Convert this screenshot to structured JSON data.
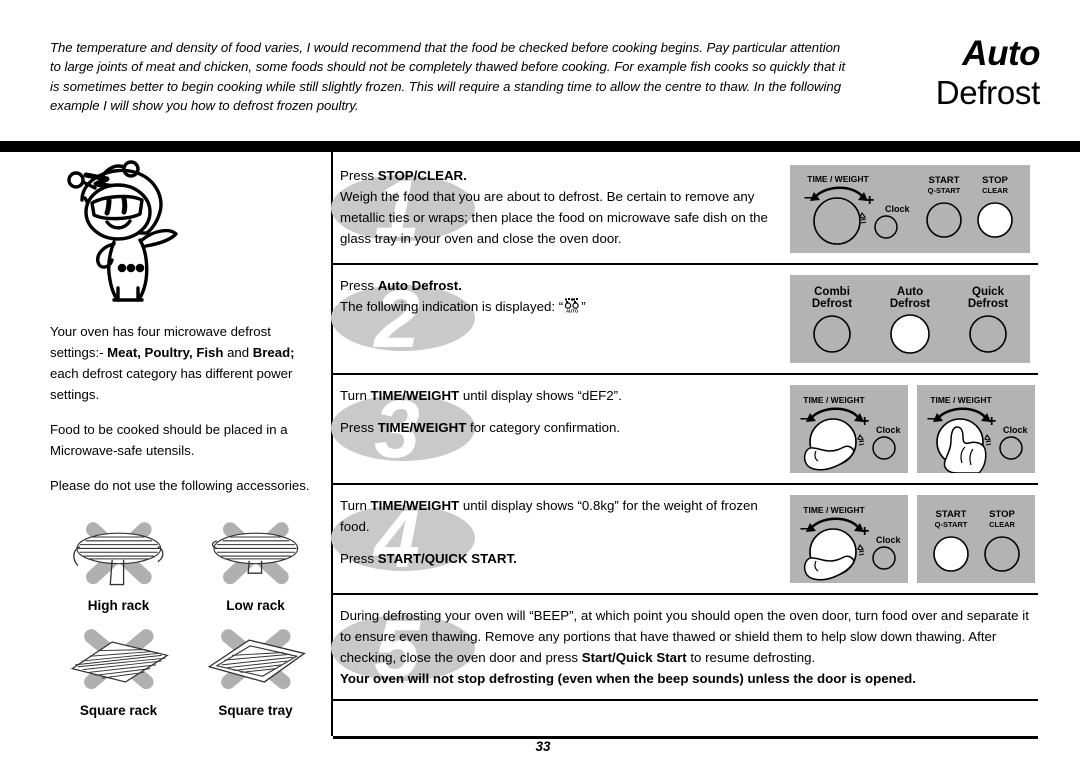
{
  "document": {
    "title_line1": "Auto",
    "title_line2": "Defrost",
    "page_number": "33",
    "intro_paragraph": "The temperature and density of food varies, I would recommend that the food be checked before cooking begins. Pay particular attention to large joints of meat and chicken, some foods should not be completely thawed before cooking. For example fish cooks so quickly that it is sometimes better to begin cooking while still slightly frozen. This will require a standing time to allow the centre to thaw. In the following example I will show you how to defrost frozen poultry."
  },
  "sidebar": {
    "mascot_alt": "chef-mascot-character",
    "paragraph1_pre": "Your oven has four microwave defrost settings:- ",
    "paragraph1_bold1": "Meat, Poultry, Fish",
    "paragraph1_mid": " and ",
    "paragraph1_bold2": "Bread;",
    "paragraph1_post": " each defrost category has different power settings.",
    "paragraph2": "Food to be cooked should be placed in a Microwave-safe utensils.",
    "paragraph3": "Please do not use the following accessories.",
    "accessories": [
      {
        "label": "High rack",
        "icon": "high-rack-icon"
      },
      {
        "label": "Low rack",
        "icon": "low-rack-icon"
      },
      {
        "label": "Square rack",
        "icon": "square-rack-icon"
      },
      {
        "label": "Square tray",
        "icon": "square-tray-icon"
      }
    ]
  },
  "steps": [
    {
      "number": "1",
      "line1_pre": "Press ",
      "line1_bold": "STOP/CLEAR.",
      "body": "Weigh the food that you are about to defrost. Be certain to remove any metallic ties or wraps; then place the food on microwave safe dish on the glass tray in your oven and close the oven door."
    },
    {
      "number": "2",
      "line1_pre": "Press ",
      "line1_bold": "Auto Defrost.",
      "body_pre": "The following indication is displayed: “",
      "display_icon": "auto-defrost-display-icon",
      "display_icon_label": "AUTO",
      "body_post": "”"
    },
    {
      "number": "3",
      "line1_pre": "Turn ",
      "line1_bold": "TIME/WEIGHT",
      "line1_post": " until display shows “dEF2”.",
      "line2_pre": "Press ",
      "line2_bold": "TIME/WEIGHT",
      "line2_post": " for category confirmation."
    },
    {
      "number": "4",
      "line1_pre": "Turn ",
      "line1_bold": "TIME/WEIGHT",
      "line1_post": " until display shows “0.8kg” for the weight of frozen food.",
      "line2_pre": "Press ",
      "line2_bold": "START/QUICK START."
    },
    {
      "number": "5",
      "body_pre": "During defrosting your oven will “BEEP”, at which point you should open the oven door, turn food over and separate it to ensure even thawing. Remove any portions that have thawed or shield them to help slow down thawing. After checking, close the oven door and press ",
      "body_bold": "Start/Quick Start",
      "body_post": " to resume defrosting.",
      "warning": "Your oven will not stop defrosting (even when the beep sounds) unless the door is opened."
    }
  ],
  "control_panels": {
    "labels": {
      "time_weight": "TIME / WEIGHT",
      "clock": "Clock",
      "start": "START",
      "q_start": "Q-START",
      "stop": "STOP",
      "clear": "CLEAR",
      "combi": "Combi",
      "auto": "Auto",
      "quick": "Quick",
      "defrost": "Defrost",
      "minus": "–",
      "plus": "+"
    },
    "colors": {
      "panel_bg": "#b3b3b3",
      "button_fill": "#b3b3b3",
      "button_highlight": "#ffffff",
      "outline": "#000000",
      "watermark": "#c9c9c9"
    },
    "step1": {
      "highlighted_button": "stop-clear-button"
    },
    "step2": {
      "highlighted_button": "auto-defrost-button"
    },
    "step3": {
      "highlighted_controls": [
        "time-weight-dial-turn",
        "time-weight-dial-press"
      ]
    },
    "step4": {
      "highlighted_button": "start-quick-start-button"
    }
  }
}
